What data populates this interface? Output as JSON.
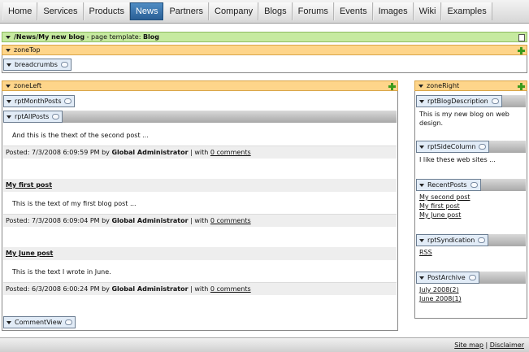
{
  "nav": {
    "items": [
      "Home",
      "Services",
      "Products",
      "News",
      "Partners",
      "Company",
      "Blogs",
      "Forums",
      "Events",
      "Images",
      "Wiki",
      "Examples"
    ],
    "active": "News"
  },
  "page_bar": {
    "path": "/News/My new blog",
    "template_prefix": " - page template: ",
    "template": "Blog"
  },
  "zone_top": {
    "label": "zoneTop",
    "webparts": {
      "breadcrumbs": "breadcrumbs"
    }
  },
  "zone_left": {
    "label": "zoneLeft",
    "webparts": {
      "month_posts": "rptMonthPosts",
      "all_posts": "rptAllPosts",
      "comment_view": "CommentView"
    },
    "posts": [
      {
        "title": "",
        "body": "And this is the thext of the second post ...",
        "posted_prefix": "Posted: 7/3/2008 6:09:59 PM by ",
        "author": "Global Administrator",
        "sep": " | with ",
        "comments": "0 comments"
      },
      {
        "title": "My first post",
        "body": "This is the text of my first blog post ...",
        "posted_prefix": "Posted: 7/3/2008 6:09:04 PM by ",
        "author": "Global Administrator",
        "sep": " | with ",
        "comments": "0 comments"
      },
      {
        "title": "My June post",
        "body": "This is the text I wrote in June.",
        "posted_prefix": "Posted: 6/3/2008 6:00:24 PM by ",
        "author": "Global Administrator",
        "sep": " | with ",
        "comments": "0 comments"
      }
    ]
  },
  "zone_right": {
    "label": "zoneRight",
    "blog_description": {
      "title": "rptBlogDescription",
      "text": "This is my new blog on web design."
    },
    "side_column": {
      "title": "rptSideColumn",
      "text": "I like these web sites ..."
    },
    "recent_posts": {
      "title": "RecentPosts",
      "links": [
        "My second post",
        "My first post",
        "My June post"
      ]
    },
    "syndication": {
      "title": "rptSyndication",
      "link": "RSS"
    },
    "post_archive": {
      "title": "PostArchive",
      "links": [
        "July 2008(2)",
        "June 2008(1)"
      ]
    }
  },
  "footer": {
    "sitemap": "Site map",
    "sep": " | ",
    "disclaimer": "Disclaimer"
  },
  "colors": {
    "nav_active": "#2f6ea8",
    "page_bar": "#c6eaa0",
    "zone_bar": "#fed58a",
    "chip": "#e2ecf7"
  }
}
